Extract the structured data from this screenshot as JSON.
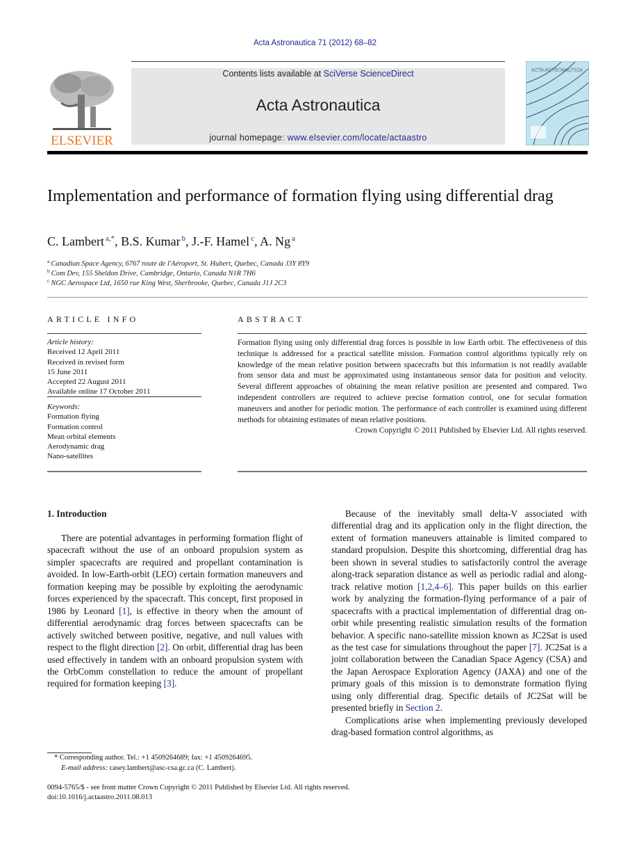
{
  "header": {
    "citation": "Acta Astronautica 71 (2012) 68–82",
    "contents_prefix": "Contents lists available at ",
    "contents_link": "SciVerse ScienceDirect",
    "journal_name": "Acta Astronautica",
    "homepage_prefix": "journal homepage: ",
    "homepage_link": "www.elsevier.com/locate/actaastro",
    "publisher_logo_text": "ELSEVIER",
    "cover_title": "ACTA ASTRONAUTICA",
    "publisher_color": "#e87722",
    "link_color": "#1d2a8c"
  },
  "article": {
    "title": "Implementation and performance of formation flying using differential drag",
    "authors": [
      {
        "name": "C. Lambert",
        "sup": "a,*"
      },
      {
        "name": "B.S. Kumar",
        "sup": "b"
      },
      {
        "name": "J.-F. Hamel",
        "sup": "c"
      },
      {
        "name": "A. Ng",
        "sup": "a"
      }
    ],
    "affiliations": [
      {
        "key": "a",
        "text": "Canadian Space Agency, 6767 route de l'Aéroport, St. Hubert, Quebec, Canada J3Y 8Y9"
      },
      {
        "key": "b",
        "text": "Com Dev, 155 Sheldon Drive, Cambridge, Ontario, Canada N1R 7H6"
      },
      {
        "key": "c",
        "text": "NGC Aerospace Ltd, 1650 rue King West, Sherbrooke, Quebec, Canada J1J 2C3"
      }
    ]
  },
  "article_info": {
    "heading": "ARTICLE INFO",
    "history_label": "Article history:",
    "history": [
      "Received 12 April 2011",
      "Received in revised form",
      "15 June 2011",
      "Accepted 22 August 2011",
      "Available online 17 October 2011"
    ],
    "keywords_label": "Keywords:",
    "keywords": [
      "Formation flying",
      "Formation control",
      "Mean orbital elements",
      "Aerodynamic drag",
      "Nano-satellites"
    ]
  },
  "abstract": {
    "heading": "ABSTRACT",
    "text": "Formation flying using only differential drag forces is possible in low Earth orbit. The effectiveness of this technique is addressed for a practical satellite mission. Formation control algorithms typically rely on knowledge of the mean relative position between spacecrafts but this information is not readily available from sensor data and must be approximated using instantaneous sensor data for position and velocity. Several different approaches of obtaining the mean relative position are presented and compared. Two independent controllers are required to achieve precise formation control, one for secular formation maneuvers and another for periodic motion. The performance of each controller is examined using different methods for obtaining estimates of mean relative positions.",
    "copyright": "Crown Copyright © 2011 Published by Elsevier Ltd. All rights reserved."
  },
  "body": {
    "section1_heading": "1.  Introduction",
    "p1": [
      "There are potential advantages in performing formation flight of spacecraft without the use of an onboard propulsion system as simpler spacecrafts are required and propellant contamination is avoided. In low-Earth-orbit (LEO) certain formation maneuvers and formation keeping may be possible by exploiting the aerodynamic forces experienced by the spacecraft. This concept, first proposed in 1986 by Leonard ",
      "[1]",
      ", is effective in theory when the amount of differential aerodynamic drag forces between spacecrafts can be actively switched between positive, negative, and null values with respect to the flight direction ",
      "[2]",
      ". On orbit, differential drag has been used effectively in tandem with an onboard propulsion system with the OrbComm constellation to reduce the amount of propellant required for formation keeping ",
      "[3]",
      "."
    ],
    "p2": [
      "Because of the inevitably small delta-V associated with differential drag and its application only in the flight direction, the extent of formation maneuvers attainable is limited compared to standard propulsion. Despite this shortcoming, differential drag has been shown in several studies to satisfactorily control the average along-track separation distance as well as periodic radial and along-track relative motion ",
      "[1,2,4–6]",
      ". This paper builds on this earlier work by analyzing the formation-flying performance of a pair of spacecrafts with a practical implementation of differential drag on-orbit while presenting realistic simulation results of the formation behavior. A specific nano-satellite mission known as JC2Sat is used as the test case for simulations throughout the paper ",
      "[7]",
      ". JC2Sat is a joint collaboration between the Canadian Space Agency (CSA) and the Japan Aerospace Exploration Agency (JAXA) and one of the primary goals of this mission is to demonstrate formation flying using only differential drag. Specific details of JC2Sat will be presented briefly in ",
      "Section 2",
      "."
    ],
    "p3": "Complications arise when implementing previously developed drag-based formation control algorithms, as"
  },
  "footnote": {
    "corresponding": "* Corresponding author. Tel.: +1 4509264689; fax: +1 4509264695.",
    "email_label": "E-mail address: ",
    "email": "casey.lambert@asc-csa.gc.ca (C. Lambert)."
  },
  "bottom": {
    "issn_line": "0094-5765/$ - see front matter Crown Copyright © 2011 Published by Elsevier Ltd. All rights reserved.",
    "doi": "doi:10.1016/j.actaastro.2011.08.013"
  }
}
